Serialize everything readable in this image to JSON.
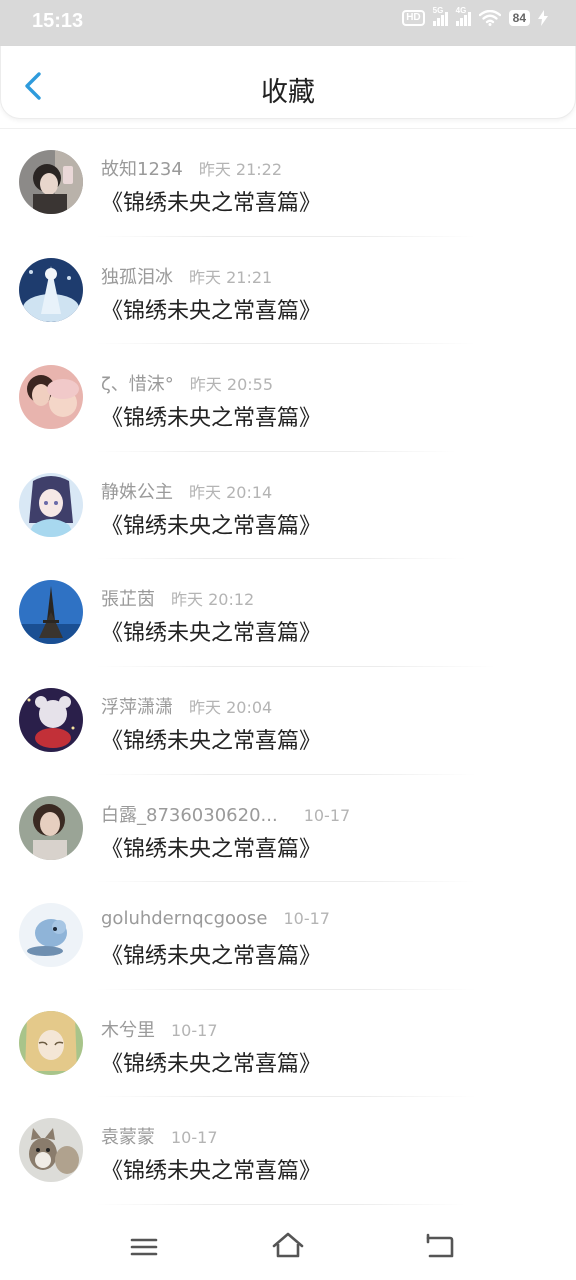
{
  "status": {
    "time": "15:13",
    "hd": "HD",
    "net1": "5G",
    "net2": "4G",
    "battery": "84"
  },
  "header": {
    "title": "收藏",
    "back_icon": "chevron-left-icon",
    "accent": "#2e9bdc"
  },
  "items": [
    {
      "name": "故知1234",
      "time": "昨天 21:22",
      "title": "《锦绣未央之常喜篇》"
    },
    {
      "name": "独孤泪冰",
      "time": "昨天 21:21",
      "title": "《锦绣未央之常喜篇》"
    },
    {
      "name": "ζ、惜沫°",
      "time": "昨天 20:55",
      "title": "《锦绣未央之常喜篇》"
    },
    {
      "name": "静姝公主",
      "time": "昨天 20:14",
      "title": "《锦绣未央之常喜篇》"
    },
    {
      "name": "張芷茵",
      "time": "昨天 20:12",
      "title": "《锦绣未央之常喜篇》"
    },
    {
      "name": "浮萍潇潇",
      "time": "昨天 20:04",
      "title": "《锦绣未央之常喜篇》"
    },
    {
      "name": "白露_8736030620...",
      "time": "10-17",
      "title": "《锦绣未央之常喜篇》"
    },
    {
      "name": "goluhdernqcgoose",
      "time": "10-17",
      "title": "《锦绣未央之常喜篇》"
    },
    {
      "name": "木兮里",
      "time": "10-17",
      "title": "《锦绣未央之常喜篇》"
    },
    {
      "name": "袁蒙蒙",
      "time": "10-17",
      "title": "《锦绣未央之常喜篇》"
    }
  ],
  "navbar": {
    "menu_icon": "menu-icon",
    "home_icon": "home-icon",
    "back_icon": "back-icon"
  }
}
